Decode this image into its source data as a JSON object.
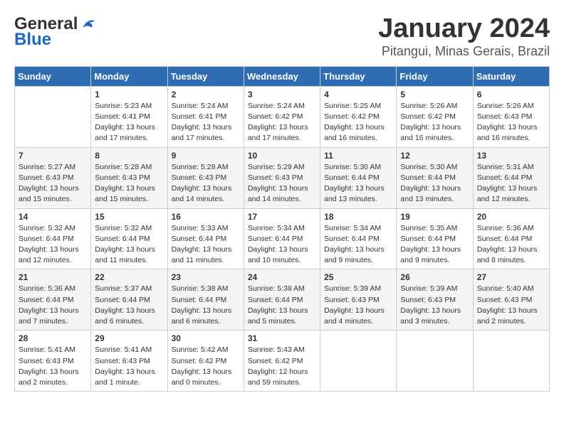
{
  "header": {
    "logo_general": "General",
    "logo_blue": "Blue",
    "month_title": "January 2024",
    "location": "Pitangui, Minas Gerais, Brazil"
  },
  "days_of_week": [
    "Sunday",
    "Monday",
    "Tuesday",
    "Wednesday",
    "Thursday",
    "Friday",
    "Saturday"
  ],
  "weeks": [
    [
      {
        "day": "",
        "info": ""
      },
      {
        "day": "1",
        "info": "Sunrise: 5:23 AM\nSunset: 6:41 PM\nDaylight: 13 hours\nand 17 minutes."
      },
      {
        "day": "2",
        "info": "Sunrise: 5:24 AM\nSunset: 6:41 PM\nDaylight: 13 hours\nand 17 minutes."
      },
      {
        "day": "3",
        "info": "Sunrise: 5:24 AM\nSunset: 6:42 PM\nDaylight: 13 hours\nand 17 minutes."
      },
      {
        "day": "4",
        "info": "Sunrise: 5:25 AM\nSunset: 6:42 PM\nDaylight: 13 hours\nand 16 minutes."
      },
      {
        "day": "5",
        "info": "Sunrise: 5:26 AM\nSunset: 6:42 PM\nDaylight: 13 hours\nand 16 minutes."
      },
      {
        "day": "6",
        "info": "Sunrise: 5:26 AM\nSunset: 6:43 PM\nDaylight: 13 hours\nand 16 minutes."
      }
    ],
    [
      {
        "day": "7",
        "info": "Sunrise: 5:27 AM\nSunset: 6:43 PM\nDaylight: 13 hours\nand 15 minutes."
      },
      {
        "day": "8",
        "info": "Sunrise: 5:28 AM\nSunset: 6:43 PM\nDaylight: 13 hours\nand 15 minutes."
      },
      {
        "day": "9",
        "info": "Sunrise: 5:28 AM\nSunset: 6:43 PM\nDaylight: 13 hours\nand 14 minutes."
      },
      {
        "day": "10",
        "info": "Sunrise: 5:29 AM\nSunset: 6:43 PM\nDaylight: 13 hours\nand 14 minutes."
      },
      {
        "day": "11",
        "info": "Sunrise: 5:30 AM\nSunset: 6:44 PM\nDaylight: 13 hours\nand 13 minutes."
      },
      {
        "day": "12",
        "info": "Sunrise: 5:30 AM\nSunset: 6:44 PM\nDaylight: 13 hours\nand 13 minutes."
      },
      {
        "day": "13",
        "info": "Sunrise: 5:31 AM\nSunset: 6:44 PM\nDaylight: 13 hours\nand 12 minutes."
      }
    ],
    [
      {
        "day": "14",
        "info": "Sunrise: 5:32 AM\nSunset: 6:44 PM\nDaylight: 13 hours\nand 12 minutes."
      },
      {
        "day": "15",
        "info": "Sunrise: 5:32 AM\nSunset: 6:44 PM\nDaylight: 13 hours\nand 11 minutes."
      },
      {
        "day": "16",
        "info": "Sunrise: 5:33 AM\nSunset: 6:44 PM\nDaylight: 13 hours\nand 11 minutes."
      },
      {
        "day": "17",
        "info": "Sunrise: 5:34 AM\nSunset: 6:44 PM\nDaylight: 13 hours\nand 10 minutes."
      },
      {
        "day": "18",
        "info": "Sunrise: 5:34 AM\nSunset: 6:44 PM\nDaylight: 13 hours\nand 9 minutes."
      },
      {
        "day": "19",
        "info": "Sunrise: 5:35 AM\nSunset: 6:44 PM\nDaylight: 13 hours\nand 9 minutes."
      },
      {
        "day": "20",
        "info": "Sunrise: 5:36 AM\nSunset: 6:44 PM\nDaylight: 13 hours\nand 8 minutes."
      }
    ],
    [
      {
        "day": "21",
        "info": "Sunrise: 5:36 AM\nSunset: 6:44 PM\nDaylight: 13 hours\nand 7 minutes."
      },
      {
        "day": "22",
        "info": "Sunrise: 5:37 AM\nSunset: 6:44 PM\nDaylight: 13 hours\nand 6 minutes."
      },
      {
        "day": "23",
        "info": "Sunrise: 5:38 AM\nSunset: 6:44 PM\nDaylight: 13 hours\nand 6 minutes."
      },
      {
        "day": "24",
        "info": "Sunrise: 5:38 AM\nSunset: 6:44 PM\nDaylight: 13 hours\nand 5 minutes."
      },
      {
        "day": "25",
        "info": "Sunrise: 5:39 AM\nSunset: 6:43 PM\nDaylight: 13 hours\nand 4 minutes."
      },
      {
        "day": "26",
        "info": "Sunrise: 5:39 AM\nSunset: 6:43 PM\nDaylight: 13 hours\nand 3 minutes."
      },
      {
        "day": "27",
        "info": "Sunrise: 5:40 AM\nSunset: 6:43 PM\nDaylight: 13 hours\nand 2 minutes."
      }
    ],
    [
      {
        "day": "28",
        "info": "Sunrise: 5:41 AM\nSunset: 6:43 PM\nDaylight: 13 hours\nand 2 minutes."
      },
      {
        "day": "29",
        "info": "Sunrise: 5:41 AM\nSunset: 6:43 PM\nDaylight: 13 hours\nand 1 minute."
      },
      {
        "day": "30",
        "info": "Sunrise: 5:42 AM\nSunset: 6:42 PM\nDaylight: 13 hours\nand 0 minutes."
      },
      {
        "day": "31",
        "info": "Sunrise: 5:43 AM\nSunset: 6:42 PM\nDaylight: 12 hours\nand 59 minutes."
      },
      {
        "day": "",
        "info": ""
      },
      {
        "day": "",
        "info": ""
      },
      {
        "day": "",
        "info": ""
      }
    ]
  ]
}
